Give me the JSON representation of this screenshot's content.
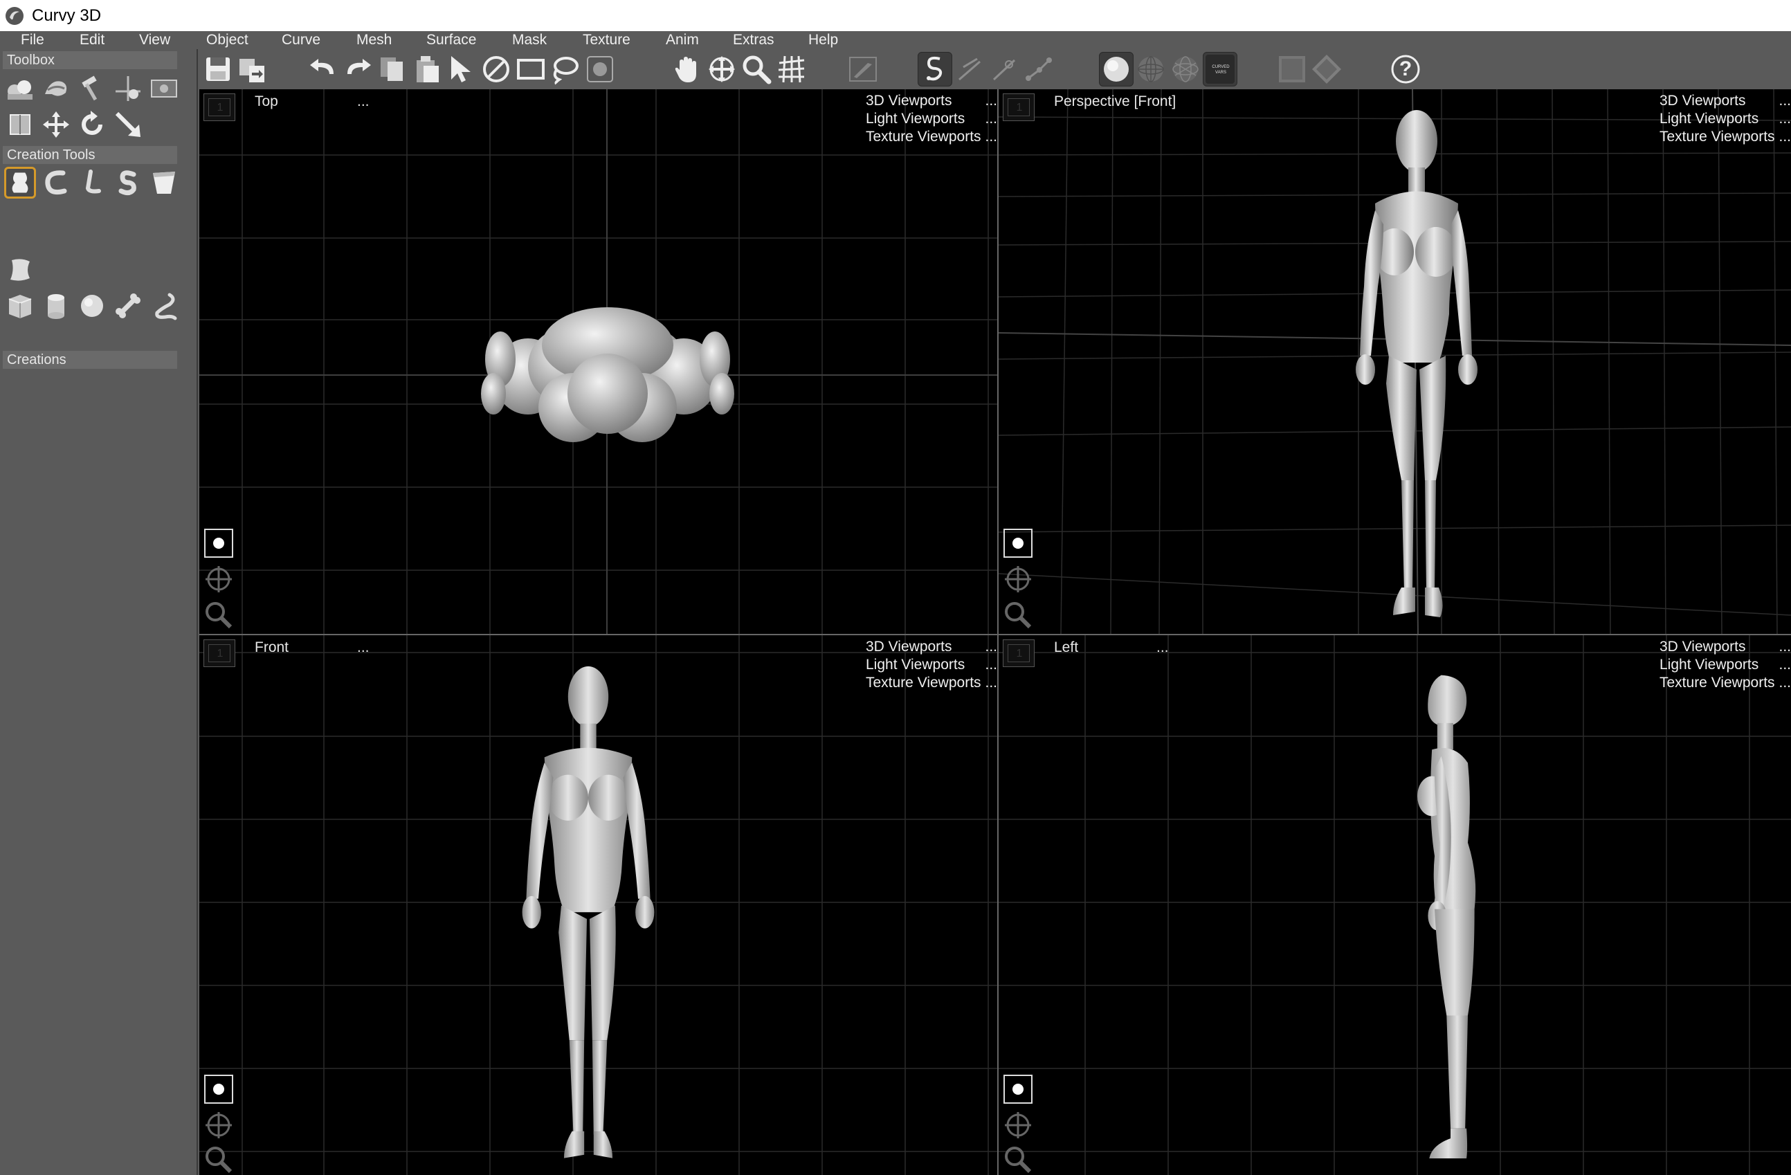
{
  "window": {
    "title": "Curvy 3D"
  },
  "menu": [
    "File",
    "Edit",
    "View",
    "Object",
    "Curve",
    "Mesh",
    "Surface",
    "Mask",
    "Texture",
    "Anim",
    "Extras",
    "Help"
  ],
  "left_panel": {
    "toolbox_label": "Toolbox",
    "creation_tools_label": "Creation Tools",
    "creations_label": "Creations"
  },
  "toolbar": {
    "help_glyph": "?",
    "curved_vars_label": "CURVED VARS"
  },
  "viewports": [
    {
      "title": "Top",
      "dots": "...",
      "menu": [
        "3D Viewports",
        "Light Viewports",
        "Texture Viewports"
      ],
      "menu_dots": "..."
    },
    {
      "title": "Perspective [Front]",
      "dots": "",
      "menu": [
        "3D Viewports",
        "Light Viewports",
        "Texture Viewports"
      ],
      "menu_dots": "..."
    },
    {
      "title": "Front",
      "dots": "...",
      "menu": [
        "3D Viewports",
        "Light Viewports",
        "Texture Viewports"
      ],
      "menu_dots": "..."
    },
    {
      "title": "Left",
      "dots": "...",
      "menu": [
        "3D Viewports",
        "Light Viewports",
        "Texture Viewports"
      ],
      "menu_dots": "..."
    }
  ],
  "viewport_corner_label": "1",
  "colors": {
    "accent": "#d59a2a",
    "panel": "#5a5a5a",
    "viewport_bg": "#000000",
    "grid": "#2e2e2e"
  }
}
